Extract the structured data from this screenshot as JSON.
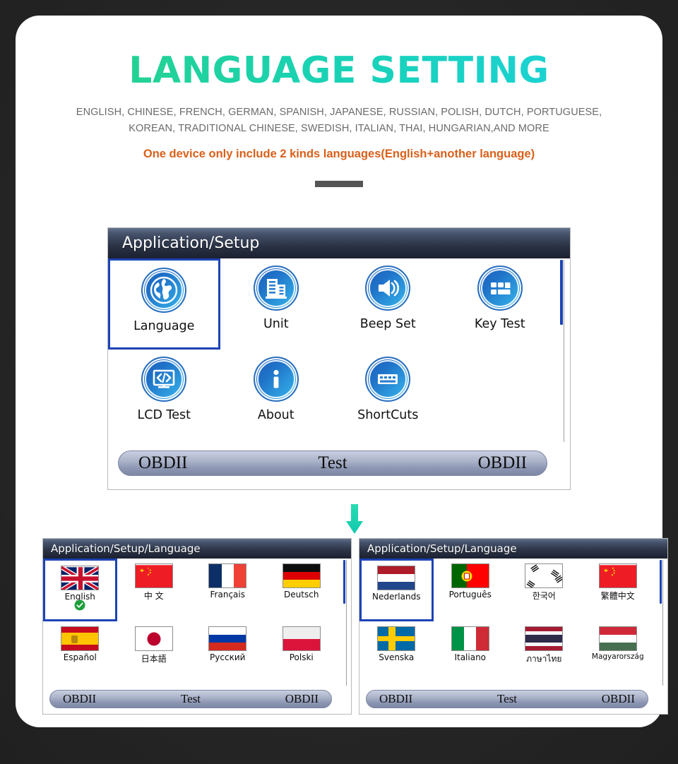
{
  "header": {
    "title": "LANGUAGE SETTING",
    "subtitle_line1": "ENGLISH, CHINESE, FRENCH, GERMAN, SPANISH, JAPANESE, RUSSIAN, POLISH, DUTCH, PORTUGUESE,",
    "subtitle_line2": "KOREAN, TRADITIONAL CHINESE, SWEDISH, ITALIAN, THAI, HUNGARIAN,AND MORE",
    "note": "One device only include 2 kinds languages(English+another language)",
    "title_gradient_start": "#2ad17f",
    "title_gradient_end": "#1ad2e0",
    "note_color": "#d9601a"
  },
  "setup_screen": {
    "breadcrumb": "Application/Setup",
    "items": [
      {
        "label": "Language",
        "icon": "globe-icon",
        "selected": true
      },
      {
        "label": "Unit",
        "icon": "building-icon",
        "selected": false
      },
      {
        "label": "Beep Set",
        "icon": "speaker-icon",
        "selected": false
      },
      {
        "label": "Key Test",
        "icon": "keypad-icon",
        "selected": false
      },
      {
        "label": "LCD Test",
        "icon": "monitor-code-icon",
        "selected": false
      },
      {
        "label": "About",
        "icon": "info-icon",
        "selected": false
      },
      {
        "label": "ShortCuts",
        "icon": "keyboard-icon",
        "selected": false
      }
    ],
    "statusbar": {
      "left": "OBDII",
      "center": "Test",
      "right": "OBDII"
    }
  },
  "language_screen_left": {
    "breadcrumb": "Application/Setup/Language",
    "items": [
      {
        "label": "English",
        "flag": "flag-uk",
        "selected": true,
        "checked": true
      },
      {
        "label": "中 文",
        "flag": "flag-china",
        "selected": false,
        "checked": false
      },
      {
        "label": "Français",
        "flag": "flag-france",
        "selected": false,
        "checked": false
      },
      {
        "label": "Deutsch",
        "flag": "flag-germany",
        "selected": false,
        "checked": false
      },
      {
        "label": "Español",
        "flag": "flag-spain",
        "selected": false,
        "checked": false
      },
      {
        "label": "日本語",
        "flag": "flag-japan",
        "selected": false,
        "checked": false
      },
      {
        "label": "Русский",
        "flag": "flag-russia",
        "selected": false,
        "checked": false
      },
      {
        "label": "Polski",
        "flag": "flag-poland",
        "selected": false,
        "checked": false
      }
    ],
    "statusbar": {
      "left": "OBDII",
      "center": "Test",
      "right": "OBDII"
    }
  },
  "language_screen_right": {
    "breadcrumb": "Application/Setup/Language",
    "items": [
      {
        "label": "Nederlands",
        "flag": "flag-netherlands",
        "selected": true,
        "checked": false
      },
      {
        "label": "Português",
        "flag": "flag-portugal",
        "selected": false,
        "checked": false
      },
      {
        "label": "한국어",
        "flag": "flag-korea",
        "selected": false,
        "checked": false
      },
      {
        "label": "繁體中文",
        "flag": "flag-china",
        "selected": false,
        "checked": false
      },
      {
        "label": "Svenska",
        "flag": "flag-sweden",
        "selected": false,
        "checked": false
      },
      {
        "label": "Italiano",
        "flag": "flag-italy",
        "selected": false,
        "checked": false
      },
      {
        "label": "ภาษาไทย",
        "flag": "flag-thailand",
        "selected": false,
        "checked": false
      },
      {
        "label": "Magyarország",
        "flag": "flag-hungary",
        "selected": false,
        "checked": false
      }
    ],
    "statusbar": {
      "left": "OBDII",
      "center": "Test",
      "right": "OBDII"
    }
  },
  "arrow": {
    "name": "down-arrow-icon",
    "color": "#1fd1b0"
  }
}
